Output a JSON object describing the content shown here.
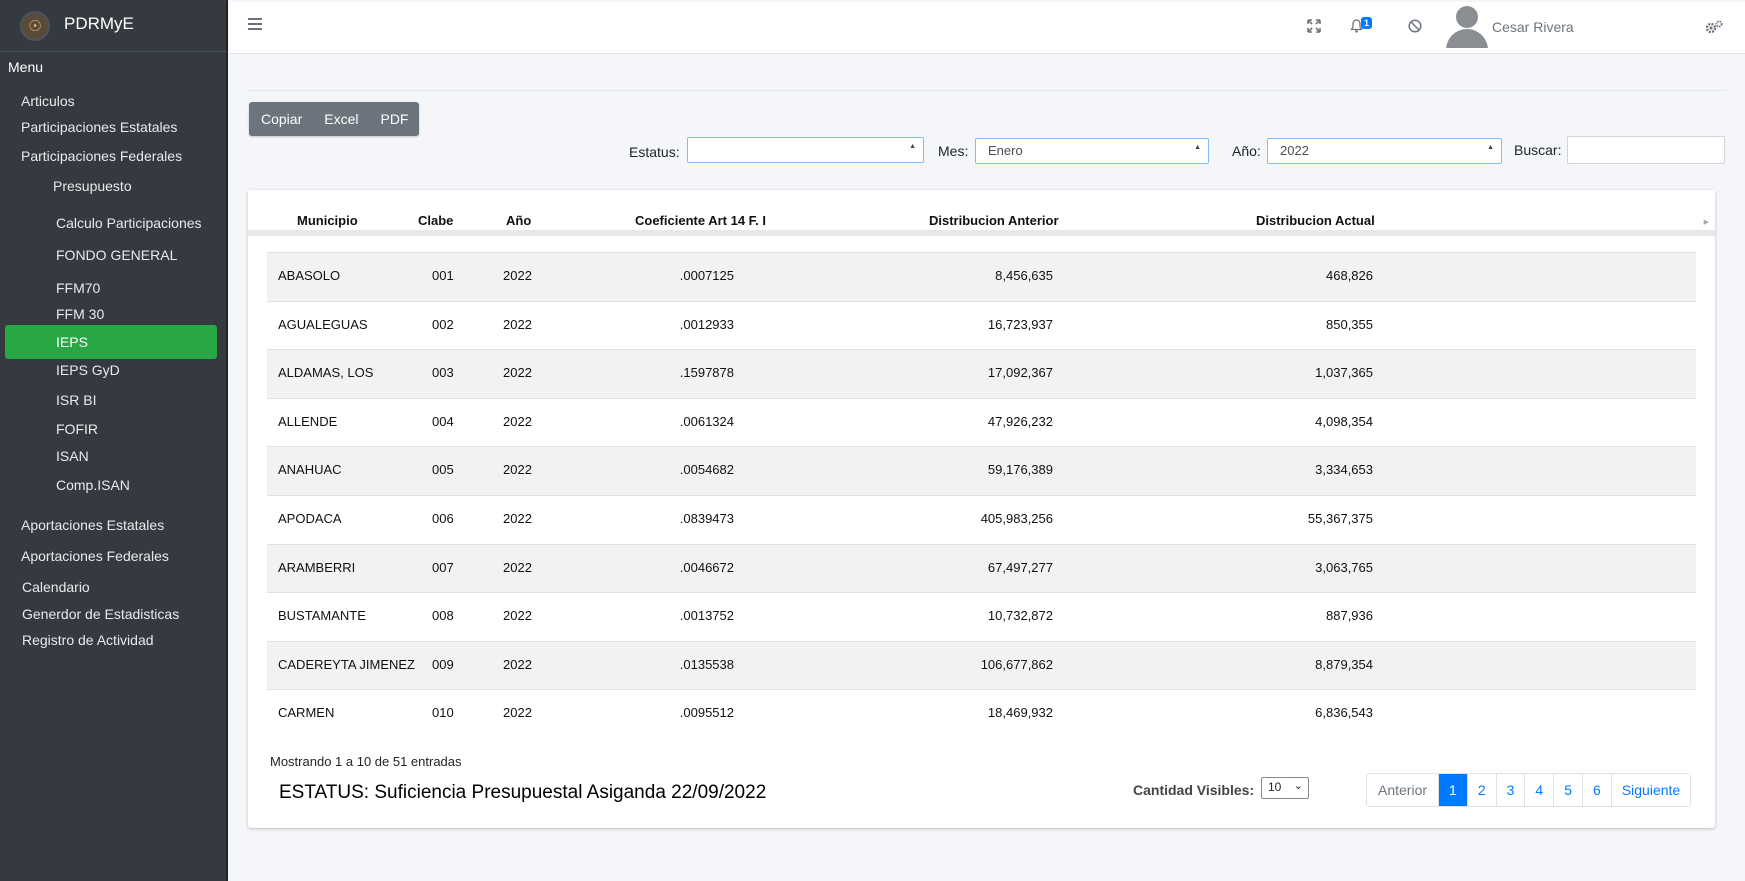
{
  "brand": {
    "name": "PDRMyE"
  },
  "sidebar": {
    "menu_header": "Menu",
    "items": [
      {
        "label": "Articulos"
      },
      {
        "label": "Participaciones Estatales"
      },
      {
        "label": "Participaciones Federales"
      },
      {
        "label": "Presupuesto"
      },
      {
        "label": "Calculo Participaciones"
      },
      {
        "label": "FONDO GENERAL"
      },
      {
        "label": "FFM70"
      },
      {
        "label": "FFM 30"
      },
      {
        "label": "IEPS",
        "active": true
      },
      {
        "label": "IEPS GyD"
      },
      {
        "label": "ISR BI"
      },
      {
        "label": "FOFIR"
      },
      {
        "label": "ISAN"
      },
      {
        "label": "Comp.ISAN"
      },
      {
        "label": "Aportaciones Estatales"
      },
      {
        "label": "Aportaciones Federales"
      },
      {
        "label": "Calendario"
      },
      {
        "label": "Generdor de Estadisticas"
      },
      {
        "label": "Registro de Actividad"
      }
    ]
  },
  "topbar": {
    "notifications_count": "1",
    "user_name": "Cesar Rivera",
    "icons": [
      "menu-icon",
      "fullscreen-icon",
      "bell-icon",
      "block-icon",
      "user-avatar",
      "cogs-icon"
    ]
  },
  "toolbar": {
    "copy_label": "Copiar",
    "excel_label": "Excel",
    "pdf_label": "PDF"
  },
  "filters": {
    "status_label": "Estatus:",
    "status_value": "",
    "month_label": "Mes:",
    "month_value": "Enero",
    "year_label": "Año:",
    "year_value": "2022",
    "search_label": "Buscar:",
    "search_value": ""
  },
  "table": {
    "headers": [
      "Municipio",
      "Clabe",
      "Año",
      "Coeficiente Art 14 F. I",
      "Distribucion Anterior",
      "Distribucion Actual"
    ],
    "rows": [
      [
        "ABASOLO",
        "001",
        "2022",
        ".0007125",
        "8,456,635",
        "468,826"
      ],
      [
        "AGUALEGUAS",
        "002",
        "2022",
        ".0012933",
        "16,723,937",
        "850,355"
      ],
      [
        "ALDAMAS, LOS",
        "003",
        "2022",
        ".1597878",
        "17,092,367",
        "1,037,365"
      ],
      [
        "ALLENDE",
        "004",
        "2022",
        ".0061324",
        "47,926,232",
        "4,098,354"
      ],
      [
        "ANAHUAC",
        "005",
        "2022",
        ".0054682",
        "59,176,389",
        "3,334,653"
      ],
      [
        "APODACA",
        "006",
        "2022",
        ".0839473",
        "405,983,256",
        "55,367,375"
      ],
      [
        "ARAMBERRI",
        "007",
        "2022",
        ".0046672",
        "67,497,277",
        "3,063,765"
      ],
      [
        "BUSTAMANTE",
        "008",
        "2022",
        ".0013752",
        "10,732,872",
        "887,936"
      ],
      [
        "CADEREYTA JIMENEZ",
        "009",
        "2022",
        ".0135538",
        "106,677,862",
        "8,879,354"
      ],
      [
        "CARMEN",
        "010",
        "2022",
        ".0095512",
        "18,469,932",
        "6,836,543"
      ]
    ]
  },
  "footer": {
    "info": "Mostrando 1 a 10 de 51 entradas",
    "status": "ESTATUS: Suficiencia Presupuestal Asiganda 22/09/2022",
    "page_size_label": "Cantidad Visibles:",
    "page_size_value": "10",
    "pagination": {
      "prev": "Anterior",
      "pages": [
        "1",
        "2",
        "3",
        "4",
        "5",
        "6"
      ],
      "active": "1",
      "next": "Siguiente"
    }
  }
}
